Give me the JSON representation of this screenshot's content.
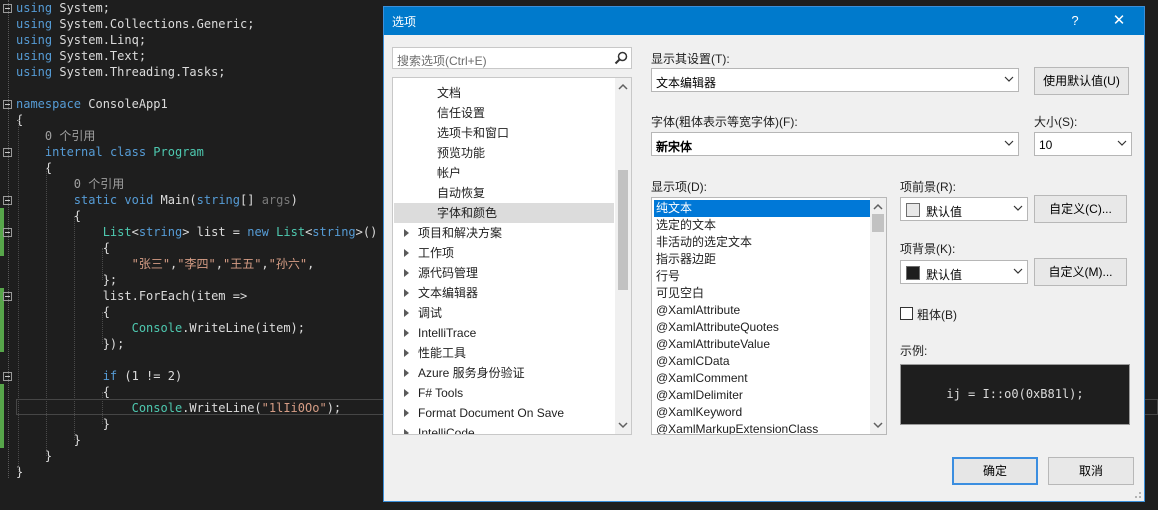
{
  "editor": {
    "lines": [
      [
        {
          "t": "using",
          "c": "kw"
        },
        {
          "t": " System;",
          "c": ""
        }
      ],
      [
        {
          "t": "using",
          "c": "kw"
        },
        {
          "t": " System.Collections.Generic;",
          "c": ""
        }
      ],
      [
        {
          "t": "using",
          "c": "kw"
        },
        {
          "t": " System.Linq;",
          "c": ""
        }
      ],
      [
        {
          "t": "using",
          "c": "kw"
        },
        {
          "t": " System.Text;",
          "c": ""
        }
      ],
      [
        {
          "t": "using",
          "c": "kw"
        },
        {
          "t": " System.Threading.Tasks;",
          "c": ""
        }
      ],
      [],
      [
        {
          "t": "namespace",
          "c": "kw"
        },
        {
          "t": " ConsoleApp1",
          "c": ""
        }
      ],
      [
        {
          "t": "{",
          "c": ""
        }
      ],
      [
        {
          "t": "    0 个引用",
          "c": "ref"
        }
      ],
      [
        {
          "t": "    ",
          "c": ""
        },
        {
          "t": "internal",
          "c": "kw"
        },
        {
          "t": " ",
          "c": ""
        },
        {
          "t": "class",
          "c": "kw"
        },
        {
          "t": " ",
          "c": ""
        },
        {
          "t": "Program",
          "c": "ty"
        }
      ],
      [
        {
          "t": "    {",
          "c": ""
        }
      ],
      [
        {
          "t": "        0 个引用",
          "c": "ref"
        }
      ],
      [
        {
          "t": "        ",
          "c": ""
        },
        {
          "t": "static",
          "c": "kw"
        },
        {
          "t": " ",
          "c": ""
        },
        {
          "t": "void",
          "c": "kw"
        },
        {
          "t": " Main(",
          "c": ""
        },
        {
          "t": "string",
          "c": "kw"
        },
        {
          "t": "[] ",
          "c": ""
        },
        {
          "t": "args",
          "c": "ws"
        },
        {
          "t": ")",
          "c": ""
        }
      ],
      [
        {
          "t": "        {",
          "c": ""
        }
      ],
      [
        {
          "t": "            ",
          "c": ""
        },
        {
          "t": "List",
          "c": "ty"
        },
        {
          "t": "<",
          "c": ""
        },
        {
          "t": "string",
          "c": "kw"
        },
        {
          "t": "> list = ",
          "c": ""
        },
        {
          "t": "new",
          "c": "kw"
        },
        {
          "t": " ",
          "c": ""
        },
        {
          "t": "List",
          "c": "ty"
        },
        {
          "t": "<",
          "c": ""
        },
        {
          "t": "string",
          "c": "kw"
        },
        {
          "t": ">()",
          "c": ""
        }
      ],
      [
        {
          "t": "            {",
          "c": ""
        }
      ],
      [
        {
          "t": "                ",
          "c": ""
        },
        {
          "t": "\"张三\"",
          "c": "str"
        },
        {
          "t": ",",
          "c": ""
        },
        {
          "t": "\"李四\"",
          "c": "str"
        },
        {
          "t": ",",
          "c": ""
        },
        {
          "t": "\"王五\"",
          "c": "str"
        },
        {
          "t": ",",
          "c": ""
        },
        {
          "t": "\"孙六\"",
          "c": "str"
        },
        {
          "t": ",",
          "c": ""
        }
      ],
      [
        {
          "t": "            };",
          "c": ""
        }
      ],
      [
        {
          "t": "            list.ForEach(item =>",
          "c": ""
        }
      ],
      [
        {
          "t": "            {",
          "c": ""
        }
      ],
      [
        {
          "t": "                ",
          "c": ""
        },
        {
          "t": "Console",
          "c": "ty"
        },
        {
          "t": ".WriteLine(item);",
          "c": ""
        }
      ],
      [
        {
          "t": "            });",
          "c": ""
        }
      ],
      [],
      [
        {
          "t": "            ",
          "c": ""
        },
        {
          "t": "if",
          "c": "kw"
        },
        {
          "t": " (1 != 2)",
          "c": ""
        }
      ],
      [
        {
          "t": "            {",
          "c": ""
        }
      ],
      [
        {
          "t": "                ",
          "c": ""
        },
        {
          "t": "Console",
          "c": "ty"
        },
        {
          "t": ".WriteLine(",
          "c": ""
        },
        {
          "t": "\"1lIi0Oo\"",
          "c": "str"
        },
        {
          "t": ");",
          "c": ""
        }
      ],
      [
        {
          "t": "            }",
          "c": ""
        }
      ],
      [
        {
          "t": "        }",
          "c": ""
        }
      ],
      [
        {
          "t": "    }",
          "c": ""
        }
      ],
      [
        {
          "t": "}",
          "c": ""
        }
      ]
    ]
  },
  "dialog": {
    "title": "选项",
    "help_label": "?",
    "close_label": "✕",
    "search": {
      "placeholder": "搜索选项(Ctrl+E)",
      "icon": "search-icon"
    },
    "tree": {
      "items": [
        {
          "label": "文档",
          "level": 2,
          "expandable": false,
          "selected": false
        },
        {
          "label": "信任设置",
          "level": 2,
          "expandable": false,
          "selected": false
        },
        {
          "label": "选项卡和窗口",
          "level": 2,
          "expandable": false,
          "selected": false
        },
        {
          "label": "预览功能",
          "level": 2,
          "expandable": false,
          "selected": false
        },
        {
          "label": "帐户",
          "level": 2,
          "expandable": false,
          "selected": false
        },
        {
          "label": "自动恢复",
          "level": 2,
          "expandable": false,
          "selected": false
        },
        {
          "label": "字体和颜色",
          "level": 2,
          "expandable": false,
          "selected": true
        },
        {
          "label": "项目和解决方案",
          "level": 1,
          "expandable": true,
          "selected": false
        },
        {
          "label": "工作项",
          "level": 1,
          "expandable": true,
          "selected": false
        },
        {
          "label": "源代码管理",
          "level": 1,
          "expandable": true,
          "selected": false
        },
        {
          "label": "文本编辑器",
          "level": 1,
          "expandable": true,
          "selected": false
        },
        {
          "label": "调试",
          "level": 1,
          "expandable": true,
          "selected": false
        },
        {
          "label": "IntelliTrace",
          "level": 1,
          "expandable": true,
          "selected": false
        },
        {
          "label": "性能工具",
          "level": 1,
          "expandable": true,
          "selected": false
        },
        {
          "label": "Azure 服务身份验证",
          "level": 1,
          "expandable": true,
          "selected": false
        },
        {
          "label": "F# Tools",
          "level": 1,
          "expandable": true,
          "selected": false
        },
        {
          "label": "Format Document On Save",
          "level": 1,
          "expandable": true,
          "selected": false
        },
        {
          "label": "IntelliCode",
          "level": 1,
          "expandable": true,
          "selected": false
        }
      ]
    },
    "show_settings_for": {
      "label": "显示其设置(T):",
      "value": "文本编辑器"
    },
    "use_defaults_button": "使用默认值(U)",
    "font": {
      "label": "字体(粗体表示等宽字体)(F):",
      "value": "新宋体"
    },
    "size": {
      "label": "大小(S):",
      "value": "10"
    },
    "display_items": {
      "label": "显示项(D):",
      "items": [
        {
          "label": "纯文本",
          "selected": true
        },
        {
          "label": "选定的文本",
          "selected": false
        },
        {
          "label": "非活动的选定文本",
          "selected": false
        },
        {
          "label": "指示器边距",
          "selected": false
        },
        {
          "label": "行号",
          "selected": false
        },
        {
          "label": "可见空白",
          "selected": false
        },
        {
          "label": "@XamlAttribute",
          "selected": false
        },
        {
          "label": "@XamlAttributeQuotes",
          "selected": false
        },
        {
          "label": "@XamlAttributeValue",
          "selected": false
        },
        {
          "label": "@XamlCData",
          "selected": false
        },
        {
          "label": "@XamlComment",
          "selected": false
        },
        {
          "label": "@XamlDelimiter",
          "selected": false
        },
        {
          "label": "@XamlKeyword",
          "selected": false
        },
        {
          "label": "@XamlMarkupExtensionClass",
          "selected": false
        }
      ]
    },
    "foreground": {
      "label": "项前景(R):",
      "value": "默认值",
      "swatch": "#e8e8e8",
      "custom_button": "自定义(C)..."
    },
    "background": {
      "label": "项背景(K):",
      "value": "默认值",
      "swatch": "#1e1e1e",
      "custom_button": "自定义(M)..."
    },
    "bold": {
      "label": "粗体(B)",
      "checked": false
    },
    "sample": {
      "label": "示例:",
      "text": "ij = I::o0(0xB81l);"
    },
    "ok_button": "确定",
    "cancel_button": "取消",
    "colors": {
      "accent": "#007acc",
      "selection": "#0078d7"
    }
  }
}
